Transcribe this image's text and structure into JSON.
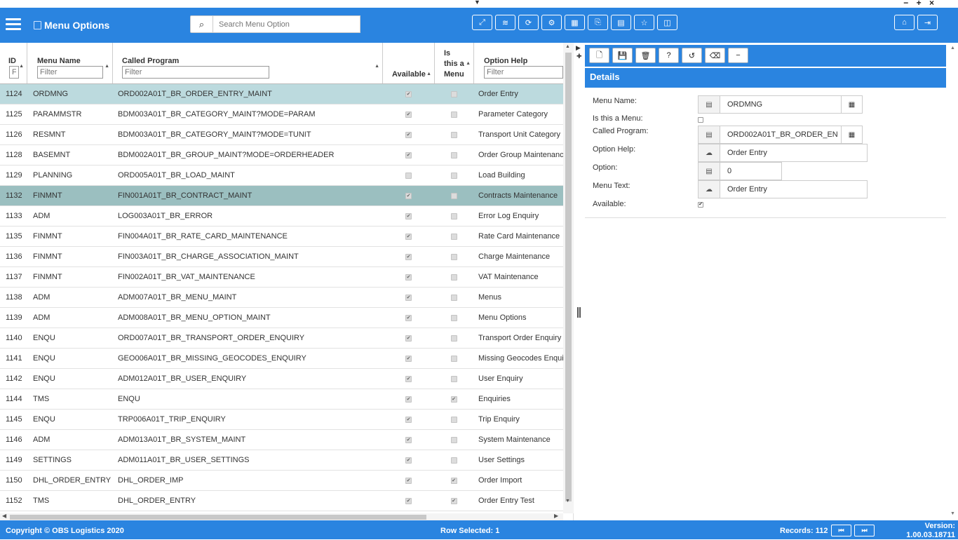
{
  "window": {
    "dropdown_glyph": "▼",
    "controls": "− + ×"
  },
  "header": {
    "title": "Menu Options",
    "search_placeholder": "Search Menu Option",
    "toolbar_icons": [
      "expand-icon",
      "database-icon",
      "refresh-icon",
      "settings-icon",
      "grid-icon",
      "export-icon",
      "document-icon",
      "star-icon",
      "columns-icon"
    ],
    "toolbar_glyphs": [
      "⤢",
      "≋",
      "⟳",
      "⚙",
      "▦",
      "⎘",
      "▤",
      "☆",
      "◫"
    ],
    "right_glyphs": [
      "⌂",
      "⇥"
    ]
  },
  "grid": {
    "columns": {
      "id": "ID",
      "name": "Menu Name",
      "program": "Called Program",
      "available": "Available",
      "menu": "Is this a Menu",
      "help": "Option Help"
    },
    "filter_placeholder": "Filter",
    "id_filter_placeholder": "Fi",
    "rows": [
      {
        "id": "1124",
        "name": "ORDMNG",
        "program": "ORD002A01T_BR_ORDER_ENTRY_MAINT",
        "available": true,
        "menu": false,
        "help": "Order Entry"
      },
      {
        "id": "1125",
        "name": "PARAMMSTR",
        "program": "BDM003A01T_BR_CATEGORY_MAINT?MODE=PARAM",
        "available": true,
        "menu": false,
        "help": "Parameter Category"
      },
      {
        "id": "1126",
        "name": "RESMNT",
        "program": "BDM003A01T_BR_CATEGORY_MAINT?MODE=TUNIT",
        "available": true,
        "menu": false,
        "help": "Transport Unit Category"
      },
      {
        "id": "1128",
        "name": "BASEMNT",
        "program": "BDM002A01T_BR_GROUP_MAINT?MODE=ORDERHEADER",
        "available": true,
        "menu": false,
        "help": "Order Group Maintenance"
      },
      {
        "id": "1129",
        "name": "PLANNING",
        "program": "ORD005A01T_BR_LOAD_MAINT",
        "available": false,
        "menu": false,
        "help": "Load Building"
      },
      {
        "id": "1132",
        "name": "FINMNT",
        "program": "FIN001A01T_BR_CONTRACT_MAINT",
        "available": true,
        "menu": false,
        "help": "Contracts Maintenance"
      },
      {
        "id": "1133",
        "name": "ADM",
        "program": "LOG003A01T_BR_ERROR",
        "available": true,
        "menu": false,
        "help": "Error Log Enquiry"
      },
      {
        "id": "1135",
        "name": "FINMNT",
        "program": "FIN004A01T_BR_RATE_CARD_MAINTENANCE",
        "available": true,
        "menu": false,
        "help": "Rate Card Maintenance"
      },
      {
        "id": "1136",
        "name": "FINMNT",
        "program": "FIN003A01T_BR_CHARGE_ASSOCIATION_MAINT",
        "available": true,
        "menu": false,
        "help": "Charge Maintenance"
      },
      {
        "id": "1137",
        "name": "FINMNT",
        "program": "FIN002A01T_BR_VAT_MAINTENANCE",
        "available": true,
        "menu": false,
        "help": "VAT Maintenance"
      },
      {
        "id": "1138",
        "name": "ADM",
        "program": "ADM007A01T_BR_MENU_MAINT",
        "available": true,
        "menu": false,
        "help": "Menus"
      },
      {
        "id": "1139",
        "name": "ADM",
        "program": "ADM008A01T_BR_MENU_OPTION_MAINT",
        "available": true,
        "menu": false,
        "help": "Menu Options"
      },
      {
        "id": "1140",
        "name": "ENQU",
        "program": "ORD007A01T_BR_TRANSPORT_ORDER_ENQUIRY",
        "available": true,
        "menu": false,
        "help": "Transport Order Enquiry"
      },
      {
        "id": "1141",
        "name": "ENQU",
        "program": "GEO006A01T_BR_MISSING_GEOCODES_ENQUIRY",
        "available": true,
        "menu": false,
        "help": "Missing Geocodes Enquir"
      },
      {
        "id": "1142",
        "name": "ENQU",
        "program": "ADM012A01T_BR_USER_ENQUIRY",
        "available": true,
        "menu": false,
        "help": "User Enquiry"
      },
      {
        "id": "1144",
        "name": "TMS",
        "program": "ENQU",
        "available": true,
        "menu": true,
        "help": "Enquiries"
      },
      {
        "id": "1145",
        "name": "ENQU",
        "program": "TRP006A01T_TRIP_ENQUIRY",
        "available": true,
        "menu": false,
        "help": "Trip Enquiry"
      },
      {
        "id": "1146",
        "name": "ADM",
        "program": "ADM013A01T_BR_SYSTEM_MAINT",
        "available": true,
        "menu": false,
        "help": "System Maintenance"
      },
      {
        "id": "1149",
        "name": "SETTINGS",
        "program": "ADM011A01T_BR_USER_SETTINGS",
        "available": true,
        "menu": false,
        "help": "User Settings"
      },
      {
        "id": "1150",
        "name": "DHL_ORDER_ENTRY",
        "program": "DHL_ORDER_IMP",
        "available": true,
        "menu": true,
        "help": "Order Import"
      },
      {
        "id": "1152",
        "name": "TMS",
        "program": "DHL_ORDER_ENTRY",
        "available": true,
        "menu": true,
        "help": "Order Entry Test"
      }
    ]
  },
  "detail": {
    "tool_icons": [
      "new-icon",
      "save-icon",
      "delete-icon",
      "help-icon",
      "undo-icon",
      "eraser-icon",
      "minimize-icon"
    ],
    "tool_glyphs": [
      "🗋",
      "💾",
      "🗑",
      "?",
      "↺",
      "⌫",
      "−"
    ],
    "title": "Details",
    "labels": {
      "menu_name": "Menu Name:",
      "is_menu": "Is this a Menu:",
      "called_program": "Called Program:",
      "option_help": "Option Help:",
      "option": "Option:",
      "menu_text": "Menu Text:",
      "available": "Available:"
    },
    "values": {
      "menu_name": "ORDMNG",
      "called_program": "ORD002A01T_BR_ORDER_EN",
      "option_help": "Order Entry",
      "option": "0",
      "menu_text": "Order Entry"
    }
  },
  "footer": {
    "copyright": "Copyright © OBS Logistics 2020",
    "row_selected": "Row Selected: 1",
    "records": "Records: 112",
    "version_label": "Version:",
    "version": "1.00.03.18711"
  }
}
